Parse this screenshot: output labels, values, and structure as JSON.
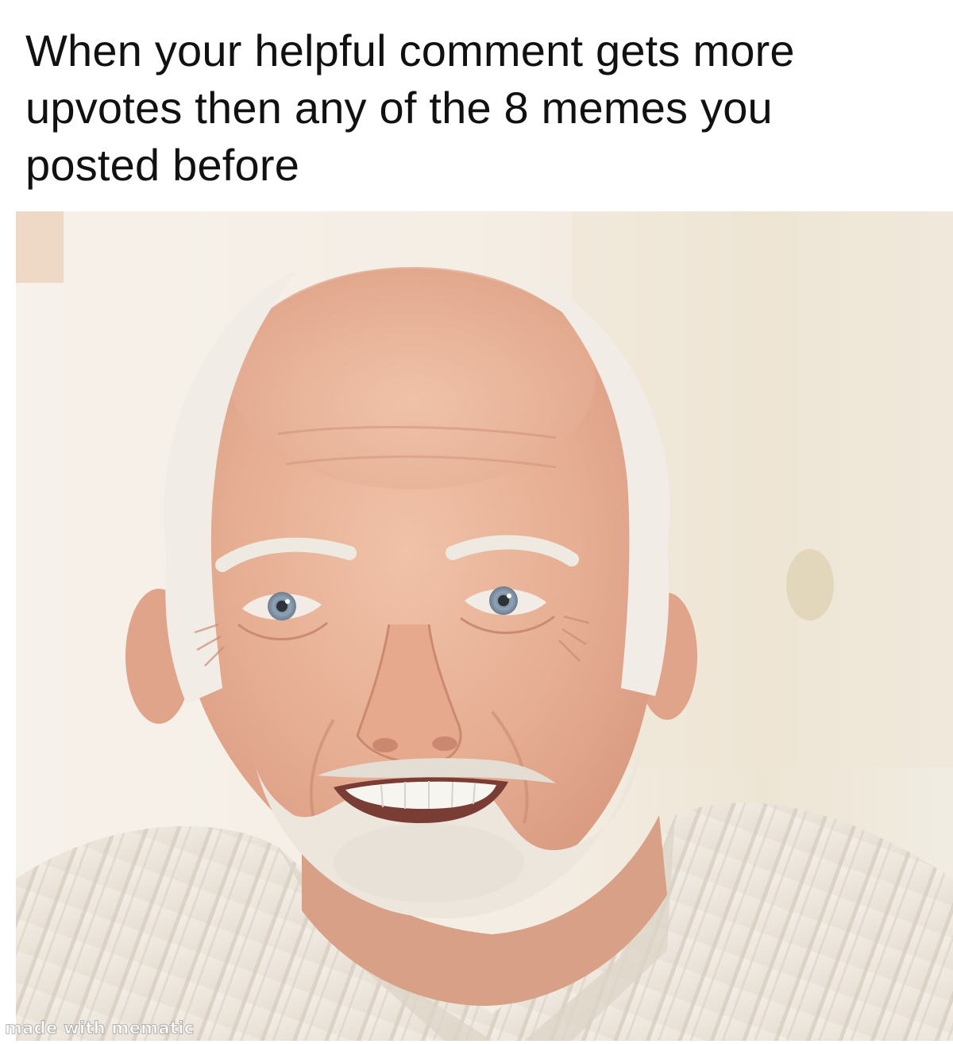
{
  "meme": {
    "caption_lines": [
      "When your helpful comment gets more",
      "upvotes then any of the 8 memes you",
      "posted before"
    ],
    "watermark": "made with mematic"
  },
  "colors": {
    "background": "#ffffff",
    "caption_text": "#111111",
    "skin": "#e8b399",
    "hair": "#f2efe9",
    "shirt": "#efe9e1"
  }
}
